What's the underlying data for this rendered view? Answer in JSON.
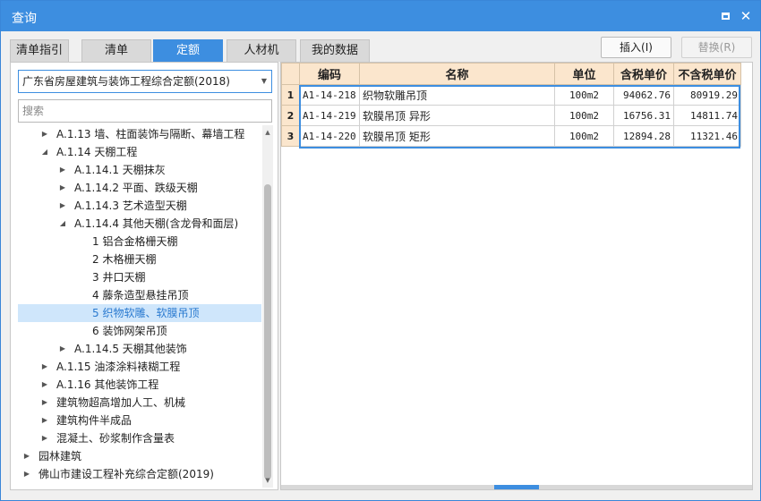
{
  "window": {
    "title": "查询"
  },
  "tabs": [
    "清单指引",
    "清单",
    "定额",
    "人材机",
    "我的数据"
  ],
  "active_tab": "定额",
  "buttons": {
    "insert": "插入(I)",
    "replace": "替换(R)"
  },
  "quota_select": {
    "value": "广东省房屋建筑与装饰工程综合定额(2018)"
  },
  "search": {
    "placeholder": "搜索"
  },
  "tree": [
    {
      "label": "A.1.13 墙、柱面装饰与隔断、幕墙工程",
      "expanded": false
    },
    {
      "label": "A.1.14 天棚工程",
      "expanded": true
    },
    {
      "label": "A.1.14.1 天棚抹灰",
      "expanded": false
    },
    {
      "label": "A.1.14.2 平面、跌级天棚",
      "expanded": false
    },
    {
      "label": "A.1.14.3 艺术造型天棚",
      "expanded": false
    },
    {
      "label": "A.1.14.4 其他天棚(含龙骨和面层)",
      "expanded": true
    },
    {
      "label": "1 铝合金格栅天棚"
    },
    {
      "label": "2 木格栅天棚"
    },
    {
      "label": "3 井口天棚"
    },
    {
      "label": "4 藤条造型悬挂吊顶"
    },
    {
      "label": "5 织物软雕、软膜吊顶",
      "selected": true
    },
    {
      "label": "6 装饰网架吊顶"
    },
    {
      "label": "A.1.14.5 天棚其他装饰",
      "expanded": false
    },
    {
      "label": "A.1.15 油漆涂料裱糊工程",
      "expanded": false
    },
    {
      "label": "A.1.16 其他装饰工程",
      "expanded": false
    },
    {
      "label": "建筑物超高增加人工、机械",
      "expanded": false
    },
    {
      "label": "建筑构件半成品",
      "expanded": false
    },
    {
      "label": "混凝土、砂浆制作含量表",
      "expanded": false
    },
    {
      "label": "园林建筑",
      "expanded": false
    },
    {
      "label": "佛山市建设工程补充综合定额(2019)",
      "expanded": false
    }
  ],
  "table": {
    "columns": [
      "",
      "编码",
      "名称",
      "单位",
      "含税单价",
      "不含税单价"
    ],
    "rows": [
      {
        "no": "1",
        "code": "A1-14-218",
        "name": "织物软雕吊顶",
        "unit": "100m2",
        "price_tax": "94062.76",
        "price_notax": "80919.29"
      },
      {
        "no": "2",
        "code": "A1-14-219",
        "name": "软膜吊顶 异形",
        "unit": "100m2",
        "price_tax": "16756.31",
        "price_notax": "14811.74"
      },
      {
        "no": "3",
        "code": "A1-14-220",
        "name": "软膜吊顶 矩形",
        "unit": "100m2",
        "price_tax": "12894.28",
        "price_notax": "11321.46"
      }
    ]
  }
}
